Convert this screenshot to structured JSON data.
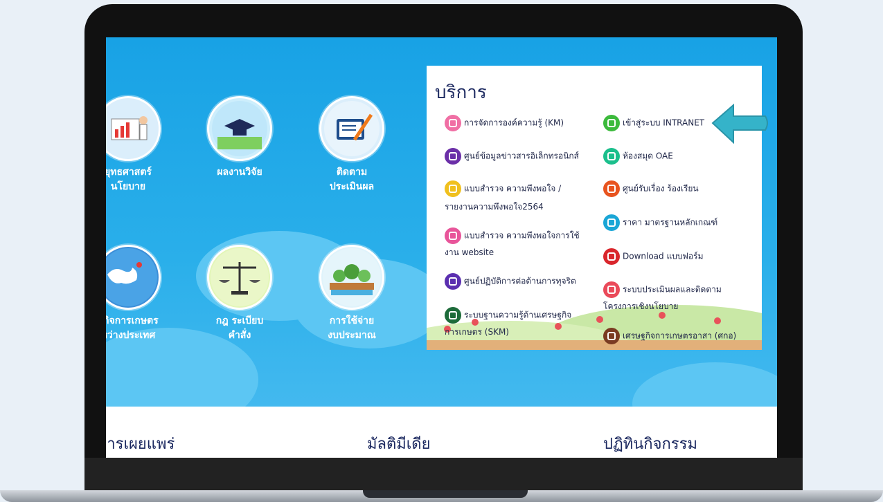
{
  "menu": [
    {
      "label": "ยุทธศาสตร์\nนโยบาย",
      "icon": "strategy-chart-icon"
    },
    {
      "label": "ผลงานวิจัย",
      "icon": "graduation-cap-icon"
    },
    {
      "label": "ติดตาม\nประเมินผล",
      "icon": "document-pen-icon"
    },
    {
      "label": "ฐกิจการเกษตร\nหว่างประเทศ",
      "icon": "world-map-icon"
    },
    {
      "label": "กฎ ระเบียบ\nคำสั่ง",
      "icon": "scales-icon"
    },
    {
      "label": "การใช้จ่าย\nงบประมาณ",
      "icon": "budget-plants-icon"
    }
  ],
  "services": {
    "title": "บริการ",
    "left": [
      {
        "label": "การจัดการองค์ความรู้ (KM)",
        "color": "#f06fa4"
      },
      {
        "label": "ศูนย์ข้อมูลข่าวสารอิเล็กทรอนิกส์",
        "color": "#6b2fa8"
      },
      {
        "label": "แบบสำรวจ ความพึงพอใจ /",
        "label2": "รายงานความพึงพอใจ2564",
        "color": "#f0c01e"
      },
      {
        "label": "แบบสำรวจ ความพึงพอใจการใช้",
        "label2": "งาน website",
        "color": "#e8559a"
      },
      {
        "label": "ศูนย์ปฏิบัติการต่อต้านการทุจริต",
        "color": "#5b2fb0"
      },
      {
        "label": "ระบบฐานความรู้ด้านเศรษฐกิจ",
        "label2": "การเกษตร (SKM)",
        "color": "#1d6b3a"
      }
    ],
    "right": [
      {
        "label": "เข้าสู่ระบบ INTRANET",
        "color": "#3cba3c"
      },
      {
        "label": "ห้องสมุด OAE",
        "color": "#1bbf8c"
      },
      {
        "label": "ศูนย์รับเรื่อง ร้องเรียน",
        "color": "#e8541f"
      },
      {
        "label": "ราคา มาตรฐานหลักเกณฑ์",
        "color": "#1aa6d6"
      },
      {
        "label": "Download แบบฟอร์ม",
        "color": "#d9262c"
      },
      {
        "label": "ระบบประเมินผลและติดตาม",
        "label2": "โครงการเชิงนโยบาย",
        "color": "#ea4a5a"
      },
      {
        "label": "เศรษฐกิจการเกษตรอาสา (ศกอ)",
        "color": "#7a3b22"
      }
    ]
  },
  "bottom": {
    "col1": "การเผยแพร่",
    "col2": "มัลติมีเดีย",
    "col3": "ปฏิทินกิจกรรม"
  },
  "colors": {
    "sky": "#1aa6e8",
    "arrow": "#35b3c9",
    "title": "#1c2960"
  }
}
